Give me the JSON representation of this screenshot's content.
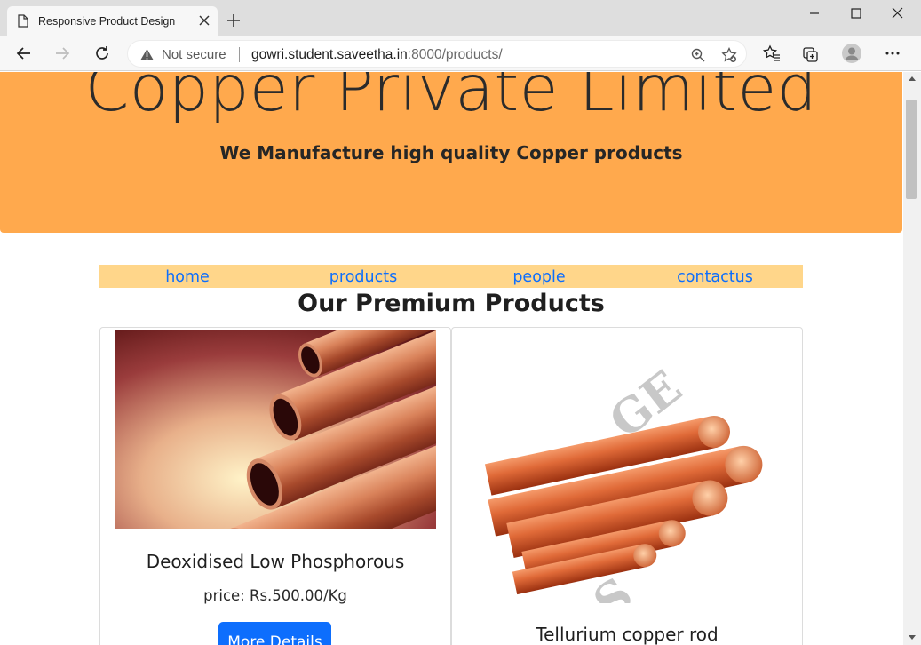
{
  "browser": {
    "tab_title": "Responsive Product Design",
    "security_label": "Not secure",
    "url_host": "gowri.student.saveetha.in",
    "url_rest": ":8000/products/"
  },
  "page": {
    "hero_title": "Copper Private Limited",
    "hero_subtitle": "We Manufacture high quality Copper products",
    "nav": [
      "home",
      "products",
      "people",
      "contactus"
    ],
    "section_title": "Our Premium Products",
    "products": [
      {
        "name": "Deoxidised Low Phosphorous",
        "price": "price: Rs.500.00/Kg",
        "button": "More Details"
      },
      {
        "name": "Tellurium copper rod"
      }
    ]
  },
  "colors": {
    "hero_bg": "#ffa94d",
    "nav_bg": "#ffd68a",
    "link": "#0d6efd",
    "button": "#0d6efd"
  }
}
